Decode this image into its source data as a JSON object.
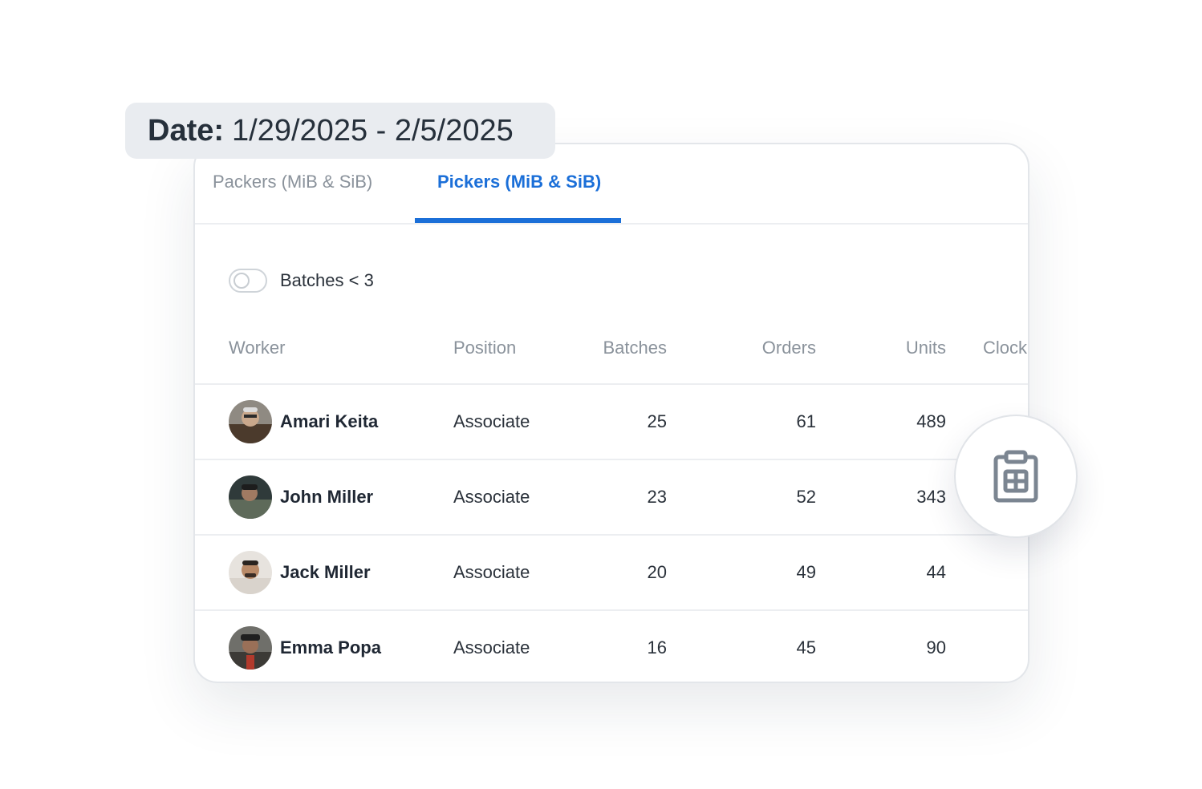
{
  "date_filter": {
    "label": "Date:",
    "range": "1/29/2025 - 2/5/2025"
  },
  "tabs": [
    {
      "label": "Packers (MiB & SiB)",
      "active": false
    },
    {
      "label": "Pickers (MiB & SiB)",
      "active": true
    }
  ],
  "filter_toggle": {
    "label": "Batches < 3",
    "on": false
  },
  "table": {
    "columns": [
      "Worker",
      "Position",
      "Batches",
      "Orders",
      "Units",
      "Clock"
    ],
    "rows": [
      {
        "worker": "Amari Keita",
        "position": "Associate",
        "batches": "25",
        "orders": "61",
        "units": "489"
      },
      {
        "worker": "John Miller",
        "position": "Associate",
        "batches": "23",
        "orders": "52",
        "units": "343"
      },
      {
        "worker": "Jack Miller",
        "position": "Associate",
        "batches": "20",
        "orders": "49",
        "units": "44"
      },
      {
        "worker": "Emma Popa",
        "position": "Associate",
        "batches": "16",
        "orders": "45",
        "units": "90"
      }
    ]
  },
  "fab": {
    "icon": "clipboard-grid-icon"
  },
  "colors": {
    "accent": "#1b6fd8",
    "muted_text": "#8a929b",
    "pill_bg": "#e9ecf0",
    "divider": "#eceef1"
  }
}
